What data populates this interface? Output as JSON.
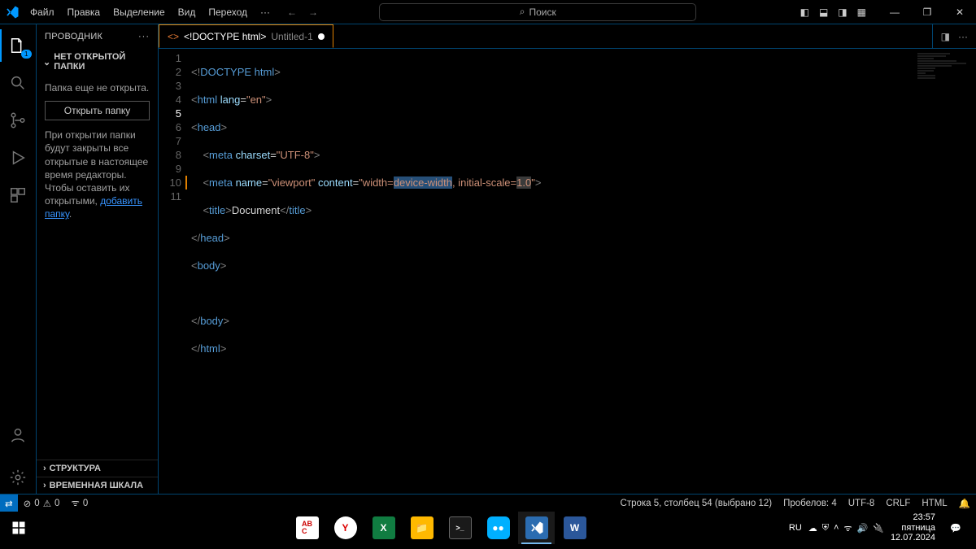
{
  "menu": {
    "file": "Файл",
    "edit": "Правка",
    "selection": "Выделение",
    "view": "Вид",
    "goto": "Переход",
    "more": "···"
  },
  "search_placeholder": "Поиск",
  "sidebar": {
    "title": "ПРОВОДНИК",
    "nofolder": "НЕТ ОТКРЫТОЙ ПАПКИ",
    "msg1": "Папка еще не открыта.",
    "open_btn": "Открыть папку",
    "msg2_a": "При открытии папки будут закрыты все открытые в настоящее время редакторы. Чтобы оставить их открытыми, ",
    "msg2_link": "добавить папку",
    "msg2_b": ".",
    "struct": "СТРУКТУРА",
    "timeline": "ВРЕМЕННАЯ ШКАЛА"
  },
  "tab": {
    "icon": "<>",
    "type": "<!DOCTYPE html>",
    "name": "Untitled-1"
  },
  "code": {
    "lines": [
      "1",
      "2",
      "3",
      "4",
      "5",
      "6",
      "7",
      "8",
      "9",
      "10",
      "11"
    ],
    "l1_a": "<!",
    "l1_b": "DOCTYPE",
    "l1_c": " html",
    "l1_d": ">",
    "l2_a": "<",
    "l2_b": "html",
    "l2_c": " lang",
    "l2_d": "=",
    "l2_e": "\"en\"",
    "l2_f": ">",
    "l3_a": "<",
    "l3_b": "head",
    "l3_c": ">",
    "l4_a": "<",
    "l4_b": "meta",
    "l4_c": " charset",
    "l4_d": "=",
    "l4_e": "\"UTF-8\"",
    "l4_f": ">",
    "l5_a": "<",
    "l5_b": "meta",
    "l5_c": " name",
    "l5_d": "=",
    "l5_e": "\"viewport\"",
    "l5_f": " content",
    "l5_g": "=",
    "l5_h": "\"width=",
    "l5_sel": "device-width",
    "l5_i": ", initial-scale=",
    "l5_hl": "1.0",
    "l5_j": "\"",
    "l5_k": ">",
    "l6_a": "<",
    "l6_b": "title",
    "l6_c": ">",
    "l6_d": "Document",
    "l6_e": "</",
    "l6_f": "title",
    "l6_g": ">",
    "l7_a": "</",
    "l7_b": "head",
    "l7_c": ">",
    "l8_a": "<",
    "l8_b": "body",
    "l8_c": ">",
    "l10_a": "</",
    "l10_b": "body",
    "l10_c": ">",
    "l11_a": "</",
    "l11_b": "html",
    "l11_c": ">"
  },
  "status": {
    "errors": "0",
    "warnings": "0",
    "ports": "0",
    "pos": "Строка 5, столбец 54 (выбрано 12)",
    "spaces": "Пробелов: 4",
    "enc": "UTF-8",
    "eol": "CRLF",
    "lang": "HTML"
  },
  "tray": {
    "lang": "RU",
    "time": "23:57",
    "day": "пятница",
    "date": "12.07.2024"
  }
}
